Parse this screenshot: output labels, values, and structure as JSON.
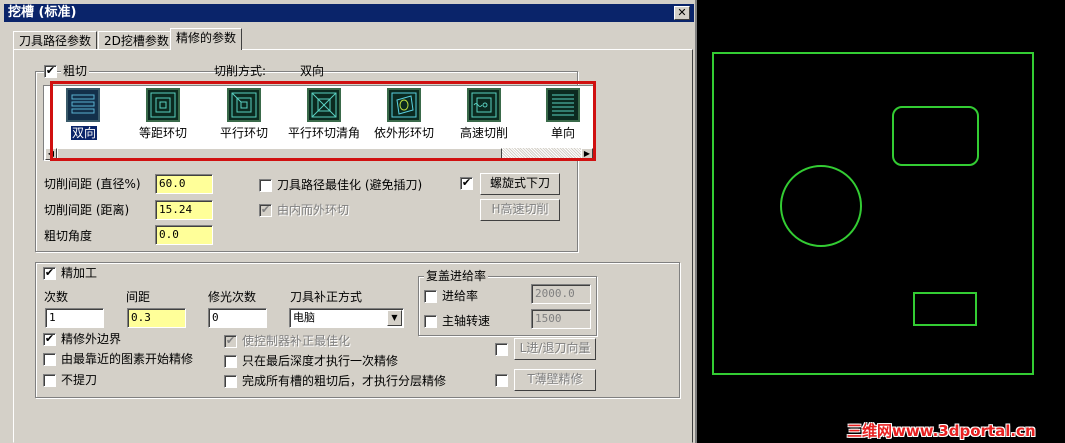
{
  "window": {
    "title": "挖槽 (标准)",
    "close_label": "✕"
  },
  "tabs": [
    {
      "label": "刀具路径参数"
    },
    {
      "label": "2D挖槽参数"
    },
    {
      "label": "精修的参数"
    }
  ],
  "rough": {
    "label": "粗切",
    "checked": true,
    "method_label": "切削方式:",
    "method_value": "双向",
    "methods": [
      {
        "label": "双向",
        "selected": true
      },
      {
        "label": "等距环切"
      },
      {
        "label": "平行环切"
      },
      {
        "label": "平行环切清角"
      },
      {
        "label": "依外形环切"
      },
      {
        "label": "高速切削"
      },
      {
        "label": "单向"
      }
    ],
    "stepover_pct_label": "切削间距 (直径%)",
    "stepover_pct": "60.0",
    "stepover_dist_label": "切削间距 (距离)",
    "stepover_dist": "15.24",
    "angle_label": "粗切角度",
    "angle": "0.0",
    "optimize_label": "刀具路径最佳化 (避免插刀)",
    "optimize_checked": false,
    "inside_out_label": "由内而外环切",
    "inside_out_checked": true,
    "helix_checked": true,
    "helix_button": "螺旋式下刀",
    "highspeed_button": "H高速切削"
  },
  "finish": {
    "label": "精加工",
    "checked": true,
    "passes_label": "次数",
    "passes": "1",
    "spacing_label": "间距",
    "spacing": "0.3",
    "spring_label": "修光次数",
    "spring": "0",
    "comp_label": "刀具补正方式",
    "comp_value": "电脑",
    "outer_label": "精修外边界",
    "outer_checked": true,
    "nearest_label": "由最靠近的图素开始精修",
    "nearest_checked": false,
    "noretract_label": "不提刀",
    "noretract_checked": false,
    "ctrl_opt_label": "使控制器补正最佳化",
    "ctrl_opt_checked": true,
    "final_depth_label": "只在最后深度才执行一次精修",
    "final_depth_checked": false,
    "after_rough_label": "完成所有槽的粗切后，才执行分层精修",
    "after_rough_checked": false,
    "leadin_button": "L进/退刀向量",
    "leadin_checked": false,
    "thinwall_button": "T薄壁精修",
    "thinwall_checked": false
  },
  "override": {
    "title": "复盖进给率",
    "feed_label": "进给率",
    "feed_value": "2000.0",
    "feed_checked": false,
    "spindle_label": "主轴转速",
    "spindle_value": "1500",
    "spindle_checked": false
  },
  "canvas": {
    "line_color": "#33dd33",
    "background": "#000000"
  },
  "watermark": "三维网www.3dportal.cn"
}
